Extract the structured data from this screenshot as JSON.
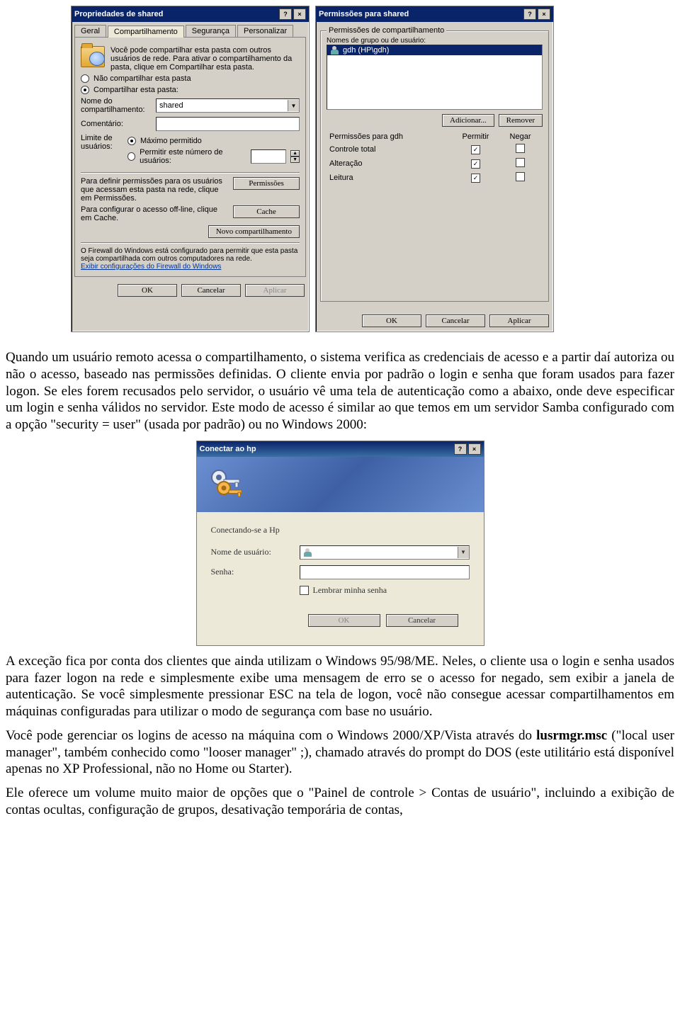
{
  "left_dialog": {
    "title": "Propriedades de shared",
    "tabs": [
      "Geral",
      "Compartilhamento",
      "Segurança",
      "Personalizar"
    ],
    "active_tab": "Compartilhamento",
    "intro": "Você pode compartilhar esta pasta com outros usuários de rede. Para ativar o compartilhamento da pasta, clique em Compartilhar esta pasta.",
    "radio_no_share": "Não compartilhar esta pasta",
    "radio_share": "Compartilhar esta pasta:",
    "share_name_label": "Nome do compartilhamento:",
    "share_name_value": "shared",
    "comment_label": "Comentário:",
    "comment_value": "",
    "user_limit_label": "Limite de usuários:",
    "radio_max": "Máximo permitido",
    "radio_num": "Permitir este número de usuários:",
    "perm_hint": "Para definir permissões para os usuários que acessam esta pasta na rede, clique em Permissões.",
    "perm_button": "Permissões",
    "cache_hint": "Para configurar o acesso off-line, clique em Cache.",
    "cache_button": "Cache",
    "new_share_button": "Novo compartilhamento",
    "firewall_text": "O Firewall do Windows está configurado para permitir que esta pasta seja compartilhada com outros computadores na rede.",
    "firewall_link": "Exibir configurações do Firewall do Windows",
    "ok": "OK",
    "cancel": "Cancelar",
    "apply": "Aplicar"
  },
  "right_dialog": {
    "title": "Permissões para shared",
    "group_label": "Permissões de compartilhamento",
    "names_label": "Nomes de grupo ou de usuário:",
    "user_entry": "gdh (HP\\gdh)",
    "add_button": "Adicionar...",
    "remove_button": "Remover",
    "perms_for_label": "Permissões para gdh",
    "hdr_allow": "Permitir",
    "hdr_deny": "Negar",
    "perm_rows": [
      "Controle total",
      "Alteração",
      "Leitura"
    ],
    "ok": "OK",
    "cancel": "Cancelar",
    "apply": "Aplicar"
  },
  "paragraph1": "Quando um usuário remoto acessa o compartilhamento, o sistema verifica as credenciais de acesso e a partir daí autoriza ou não o acesso, baseado nas permissões definidas. O cliente envia por padrão o login e senha que foram usados para fazer logon. Se eles forem recusados pelo servidor, o usuário vê uma tela de autenticação como a abaixo, onde deve especificar um login e senha válidos no servidor. Este modo de acesso é similar ao que temos em um servidor Samba configurado com a opção \"security = user\" (usada por padrão) ou no Windows 2000:",
  "connect_dialog": {
    "title": "Conectar ao hp",
    "status": "Conectando-se a Hp",
    "user_label": "Nome de usuário:",
    "user_value": "",
    "password_label": "Senha:",
    "password_value": "",
    "remember_label": "Lembrar minha senha",
    "ok": "OK",
    "cancel": "Cancelar"
  },
  "paragraph2": "A exceção fica por conta dos clientes que ainda utilizam o Windows 95/98/ME. Neles, o cliente usa o login e senha usados para fazer logon na rede e simplesmente exibe uma mensagem de erro se o acesso for negado, sem exibir a janela de autenticação. Se você simplesmente pressionar ESC na tela de logon, você não consegue acessar compartilhamentos em máquinas configuradas para utilizar o modo de segurança com base no usuário.",
  "paragraph3_pre": "Você pode gerenciar os logins de acesso na máquina com o Windows 2000/XP/Vista através do ",
  "paragraph3_bold": "lusrmgr.msc",
  "paragraph3_post": " (\"local user manager\", também conhecido como \"looser manager\" ;), chamado através do prompt do DOS (este utilitário está disponível apenas no XP Professional, não no Home ou Starter).",
  "paragraph4": "Ele oferece um volume muito maior de opções que o \"Painel de controle > Contas de usuário\", incluindo a exibição de contas ocultas, configuração de grupos, desativação temporária de contas,"
}
